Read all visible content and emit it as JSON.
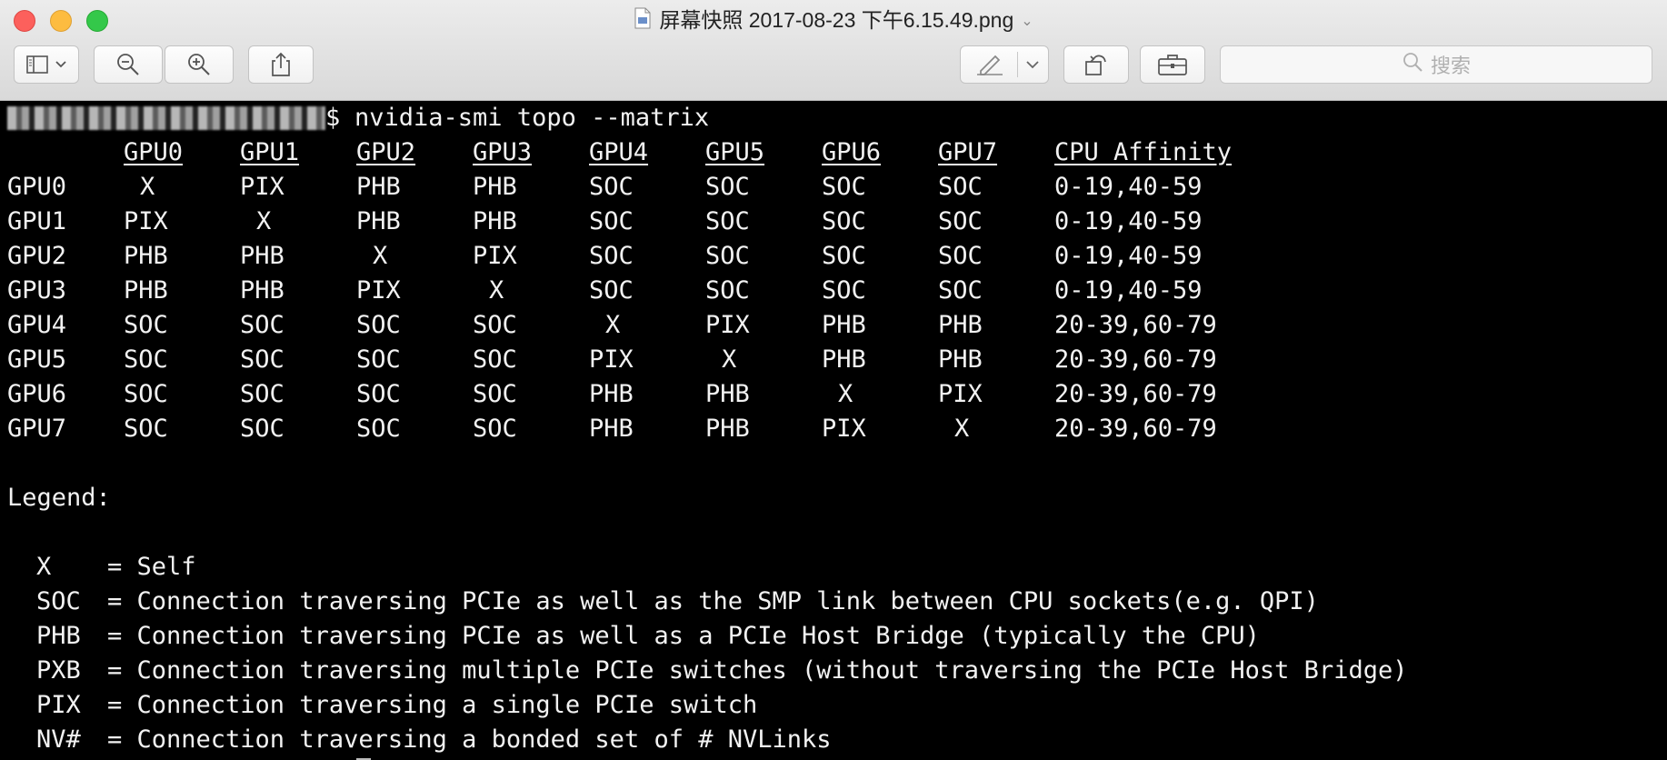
{
  "window": {
    "title": "屏幕快照 2017-08-23 下午6.15.49.png",
    "search_placeholder": "搜索"
  },
  "toolbar": {
    "buttons": [
      "sidebar-toggle-icon",
      "zoom-out-icon",
      "zoom-in-icon",
      "share-icon",
      "markup-pen-icon",
      "rotate-icon",
      "toolbox-icon"
    ]
  },
  "terminal": {
    "prompt_suffix": "$",
    "command": "nvidia-smi topo --matrix",
    "matrix": {
      "headers": [
        "GPU0",
        "GPU1",
        "GPU2",
        "GPU3",
        "GPU4",
        "GPU5",
        "GPU6",
        "GPU7",
        "CPU Affinity"
      ],
      "rows": [
        {
          "label": "GPU0",
          "cells": [
            "X",
            "PIX",
            "PHB",
            "PHB",
            "SOC",
            "SOC",
            "SOC",
            "SOC"
          ],
          "affinity": "0-19,40-59"
        },
        {
          "label": "GPU1",
          "cells": [
            "PIX",
            "X",
            "PHB",
            "PHB",
            "SOC",
            "SOC",
            "SOC",
            "SOC"
          ],
          "affinity": "0-19,40-59"
        },
        {
          "label": "GPU2",
          "cells": [
            "PHB",
            "PHB",
            "X",
            "PIX",
            "SOC",
            "SOC",
            "SOC",
            "SOC"
          ],
          "affinity": "0-19,40-59"
        },
        {
          "label": "GPU3",
          "cells": [
            "PHB",
            "PHB",
            "PIX",
            "X",
            "SOC",
            "SOC",
            "SOC",
            "SOC"
          ],
          "affinity": "0-19,40-59"
        },
        {
          "label": "GPU4",
          "cells": [
            "SOC",
            "SOC",
            "SOC",
            "SOC",
            "X",
            "PIX",
            "PHB",
            "PHB"
          ],
          "affinity": "20-39,60-79"
        },
        {
          "label": "GPU5",
          "cells": [
            "SOC",
            "SOC",
            "SOC",
            "SOC",
            "PIX",
            "X",
            "PHB",
            "PHB"
          ],
          "affinity": "20-39,60-79"
        },
        {
          "label": "GPU6",
          "cells": [
            "SOC",
            "SOC",
            "SOC",
            "SOC",
            "PHB",
            "PHB",
            "X",
            "PIX"
          ],
          "affinity": "20-39,60-79"
        },
        {
          "label": "GPU7",
          "cells": [
            "SOC",
            "SOC",
            "SOC",
            "SOC",
            "PHB",
            "PHB",
            "PIX",
            "X"
          ],
          "affinity": "20-39,60-79"
        }
      ]
    },
    "legend_title": "Legend:",
    "legend": [
      {
        "key": "X",
        "text": "= Self"
      },
      {
        "key": "SOC",
        "text": "= Connection traversing PCIe as well as the SMP link between CPU sockets(e.g. QPI)"
      },
      {
        "key": "PHB",
        "text": "= Connection traversing PCIe as well as a PCIe Host Bridge (typically the CPU)"
      },
      {
        "key": "PXB",
        "text": "= Connection traversing multiple PCIe switches (without traversing the PCIe Host Bridge)"
      },
      {
        "key": "PIX",
        "text": "= Connection traversing a single PCIe switch"
      },
      {
        "key": "NV#",
        "text": "= Connection traversing a bonded set of # NVLinks"
      }
    ]
  }
}
